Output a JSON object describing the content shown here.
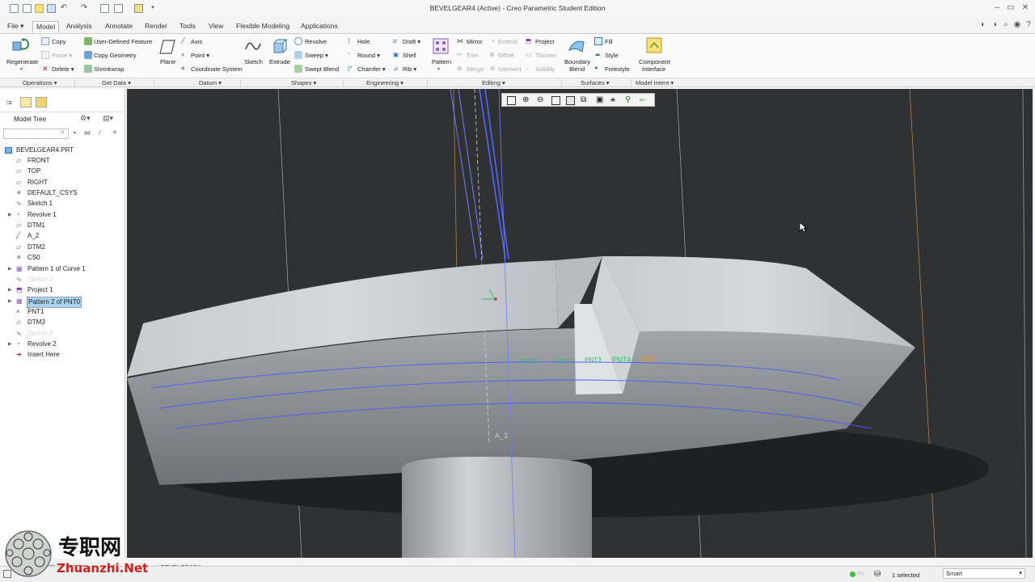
{
  "window": {
    "title": "BEVELGEAR4 (Active) - Creo Parametric Student Edition"
  },
  "tabs": [
    {
      "label": "File",
      "has_menu": true
    },
    {
      "label": "Model",
      "active": true
    },
    {
      "label": "Analysis"
    },
    {
      "label": "Annotate"
    },
    {
      "label": "Render"
    },
    {
      "label": "Tools"
    },
    {
      "label": "View"
    },
    {
      "label": "Flexible Modeling"
    },
    {
      "label": "Applications"
    }
  ],
  "ribbon": {
    "regenerate": "Regenerate",
    "copy": "Copy",
    "paste": "Paste",
    "delete": "Delete",
    "user_defined_feature": "User-Defined Feature",
    "copy_geometry": "Copy Geometry",
    "shrinkwrap": "Shrinkwrap",
    "plane": "Plane",
    "axis": "Axis",
    "point": "Point",
    "coordinate_system": "Coordinate System",
    "sketch": "Sketch",
    "extrude": "Extrude",
    "revolve": "Revolve",
    "sweep": "Sweep",
    "swept_blend": "Swept Blend",
    "hole": "Hole",
    "round": "Round",
    "chamfer": "Chamfer",
    "draft": "Draft",
    "shell": "Shell",
    "rib": "Rib",
    "pattern": "Pattern",
    "mirror": "Mirror",
    "extend": "Extend",
    "trim": "Trim",
    "offset": "Offset",
    "merge": "Merge",
    "intersect": "Intersect",
    "project": "Project",
    "thicken": "Thicken",
    "solidify": "Solidify",
    "boundary_blend_1": "Boundary",
    "boundary_blend_2": "Blend",
    "fill": "Fill",
    "style": "Style",
    "freestyle": "Freestyle",
    "component_interface_1": "Component",
    "component_interface_2": "Interface"
  },
  "groups": [
    "Operations",
    "Get Data",
    "Datum",
    "Shapes",
    "Engineering",
    "Editing",
    "Surfaces",
    "Model Intent"
  ],
  "model_tree": {
    "title": "Model Tree",
    "search_placeholder": "",
    "root": "BEVELGEAR4.PRT",
    "items": [
      {
        "label": "FRONT",
        "icon": "datum-plane-icon",
        "expandable": false,
        "state": "normal"
      },
      {
        "label": "TOP",
        "icon": "datum-plane-icon",
        "expandable": false,
        "state": "normal"
      },
      {
        "label": "RIGHT",
        "icon": "datum-plane-icon",
        "expandable": false,
        "state": "normal"
      },
      {
        "label": "DEFAULT_CSYS",
        "icon": "csys-icon",
        "expandable": false,
        "state": "normal"
      },
      {
        "label": "Sketch 1",
        "icon": "sketch-icon",
        "expandable": false,
        "state": "normal"
      },
      {
        "label": "Revolve 1",
        "icon": "revolve-icon",
        "expandable": true,
        "state": "normal"
      },
      {
        "label": "DTM1",
        "icon": "datum-plane-icon",
        "expandable": false,
        "state": "normal"
      },
      {
        "label": "A_2",
        "icon": "axis-icon",
        "expandable": false,
        "state": "normal"
      },
      {
        "label": "DTM2",
        "icon": "datum-plane-icon",
        "expandable": false,
        "state": "normal"
      },
      {
        "label": "CS0",
        "icon": "csys-icon",
        "expandable": false,
        "state": "normal"
      },
      {
        "label": "Pattern 1 of Curve 1",
        "icon": "pattern-icon",
        "expandable": true,
        "state": "normal"
      },
      {
        "label": "Sketch 2",
        "icon": "sketch-icon",
        "expandable": false,
        "state": "hidden"
      },
      {
        "label": "Project 1",
        "icon": "project-icon",
        "expandable": true,
        "state": "normal"
      },
      {
        "label": "Pattern 2 of PNT0",
        "icon": "pattern-icon",
        "expandable": true,
        "state": "selected"
      },
      {
        "label": "PNT1",
        "icon": "point-icon",
        "expandable": false,
        "state": "normal"
      },
      {
        "label": "DTM3",
        "icon": "datum-plane-icon",
        "expandable": false,
        "state": "normal"
      },
      {
        "label": "Sketch 3",
        "icon": "sketch-icon",
        "expandable": false,
        "state": "hidden"
      },
      {
        "label": "Revolve 2",
        "icon": "revolve-icon",
        "expandable": true,
        "state": "normal"
      },
      {
        "label": "Insert Here",
        "icon": "insert-here-icon",
        "expandable": false,
        "state": "normal"
      }
    ]
  },
  "viewport": {
    "labels": {
      "pnt0": "PNT0",
      "pnt2": "PNT2",
      "pnt3": "PNT3",
      "pnt4": "PNT4",
      "pnt1": "PNT1",
      "a3": "A_3"
    },
    "colors": {
      "background": "#2f3133",
      "model": "#c3c7cb",
      "datum_blue": "#4a5cff",
      "point_green": "#2fbf6a",
      "point_orange": "#d89a3a"
    }
  },
  "status": {
    "message": "Sketch PNT0 successfully created. Insert BEVELGEAR4",
    "selected": "1 selected",
    "filter": "Smart"
  },
  "watermark": {
    "cn": "专职网",
    "en": "Zhuanzhi.Net"
  }
}
